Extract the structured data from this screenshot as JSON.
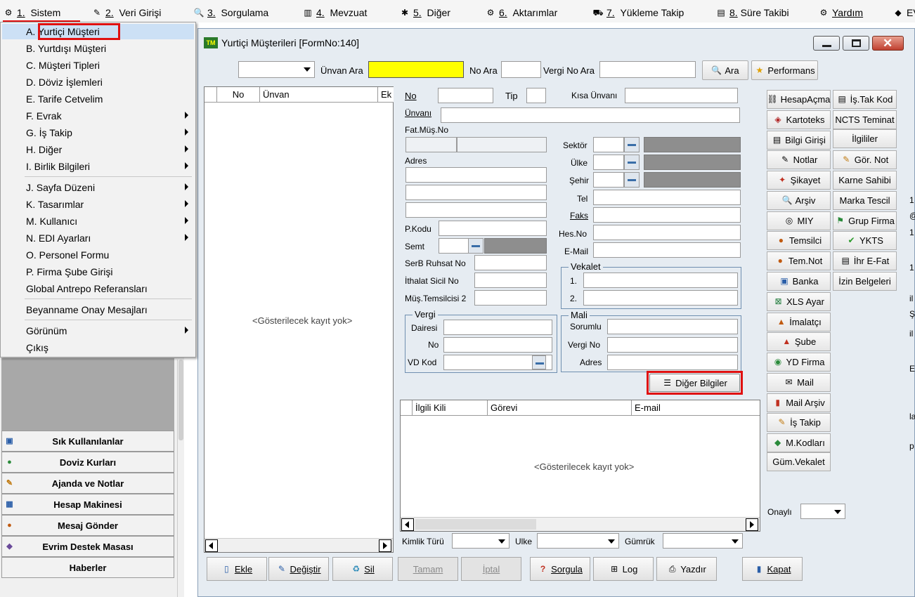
{
  "menubar": {
    "items": [
      {
        "num": "1.",
        "label": "Sistem",
        "icon": "gear-icon"
      },
      {
        "num": "2.",
        "label": "Veri Girişi",
        "icon": "pencil-icon"
      },
      {
        "num": "3.",
        "label": "Sorgulama",
        "icon": "search-icon"
      },
      {
        "num": "4.",
        "label": "Mevzuat",
        "icon": "books-icon"
      },
      {
        "num": "5.",
        "label": "Diğer",
        "icon": "tools-icon"
      },
      {
        "num": "6.",
        "label": "Aktarımlar",
        "icon": "transfer-icon"
      },
      {
        "num": "7.",
        "label": "Yükleme Takip",
        "icon": "truck-icon"
      },
      {
        "num": "8.",
        "label": "Süre Takibi",
        "icon": "clock-icon"
      },
      {
        "num": "",
        "label": "Yardım",
        "icon": "help-icon"
      },
      {
        "num": "",
        "label": "EV",
        "icon": "book-icon"
      }
    ]
  },
  "dropdown": {
    "items": [
      {
        "label": "A.  Yurtiçi Müşteri",
        "has_sub": false,
        "selected": true
      },
      {
        "label": "B.  Yurtdışı Müşteri",
        "has_sub": false
      },
      {
        "label": "C.  Müşteri Tipleri",
        "has_sub": false
      },
      {
        "label": "D.  Döviz İşlemleri",
        "has_sub": false
      },
      {
        "label": "E.  Tarife Cetvelim",
        "has_sub": false
      },
      {
        "label": "F.  Evrak",
        "has_sub": true
      },
      {
        "label": "G.  İş Takip",
        "has_sub": true
      },
      {
        "label": "H.  Diğer",
        "has_sub": true
      },
      {
        "label": "I.  Birlik Bilgileri",
        "has_sub": true
      },
      {
        "label": "J.  Sayfa Düzeni",
        "has_sub": true
      },
      {
        "label": "K.  Tasarımlar",
        "has_sub": true
      },
      {
        "label": "M.  Kullanıcı",
        "has_sub": true
      },
      {
        "label": "N.  EDI Ayarları",
        "has_sub": true
      },
      {
        "label": "O.  Personel Formu",
        "has_sub": false
      },
      {
        "label": "P.  Firma Şube Girişi",
        "has_sub": false
      },
      {
        "label": "Global Antrepo Referansları",
        "has_sub": false
      },
      {
        "label": "Beyanname Onay Mesajları",
        "has_sub": false
      },
      {
        "label": "Görünüm",
        "has_sub": true
      },
      {
        "label": "Çıkış",
        "has_sub": false
      }
    ]
  },
  "leftpanel": {
    "buttons": [
      {
        "label": "Sık Kullanılanlar",
        "icon": "star-list-icon"
      },
      {
        "label": "Doviz Kurları",
        "icon": "currency-icon"
      },
      {
        "label": "Ajanda ve Notlar",
        "icon": "notebook-icon"
      },
      {
        "label": "Hesap Makinesi",
        "icon": "calculator-icon"
      },
      {
        "label": "Mesaj Gönder",
        "icon": "users-icon"
      },
      {
        "label": "Evrim Destek Masası",
        "icon": "support-icon"
      },
      {
        "label": "Haberler",
        "icon": ""
      }
    ]
  },
  "window": {
    "title": "Yurtiçi Müşterileri [FormNo:140]",
    "search": {
      "unvan_ara": "Ünvan Ara",
      "no_ara": "No Ara",
      "vergi_no_ara": "Vergi No Ara",
      "ara_button": "Ara",
      "performans_button": "Performans"
    },
    "left_grid": {
      "columns": [
        "No",
        "Ünvan",
        "Ek"
      ],
      "empty_text": "<Gösterilecek kayıt yok>"
    },
    "form": {
      "no": "No",
      "tip": "Tip",
      "kisa_unvani": "Kısa Ünvanı",
      "unvani": "Ünvanı",
      "fat_mus_no": "Fat.Müş.No",
      "adres": "Adres",
      "pkodu": "P.Kodu",
      "semt": "Semt",
      "serb_ruhsat": "SerB Ruhsat No",
      "ithalat_sicil": "İthalat Sicil No",
      "mus_temsilcisi2": "Müş.Temsilcisi 2",
      "sektor": "Sektör",
      "ulke": "Ülke",
      "sehir": "Şehir",
      "tel": "Tel",
      "faks": "Faks",
      "hes_no": "Hes.No",
      "email": "E-Mail",
      "vekalet_group": "Vekalet",
      "vekalet_1": "1.",
      "vekalet_2": "2.",
      "vergi_group": "Vergi",
      "vergi_dairesi": "Dairesi",
      "vergi_no": "No",
      "vd_kod": "VD Kod",
      "mali_group": "Mali",
      "mali_sorumlu": "Sorumlu",
      "mali_vergi_no": "Vergi No",
      "mali_adres": "Adres",
      "diger_bilgiler": "Diğer Bilgiler"
    },
    "contact_grid": {
      "columns": [
        "İlgili Kili",
        "Görevi",
        "E-mail"
      ],
      "empty_text": "<Gösterilecek kayıt yok>"
    },
    "filters": {
      "kimlik_turu": "Kimlik Türü",
      "ulke": "Ulke",
      "gumruk": "Gümrük"
    },
    "right_buttons_col1": [
      {
        "label": "HesapAçma",
        "icon": "link-icon"
      },
      {
        "label": "Kartoteks",
        "icon": "card-icon"
      },
      {
        "label": "Bilgi Girişi",
        "icon": "info-icon"
      },
      {
        "label": "Notlar",
        "icon": "notes-icon"
      },
      {
        "label": "Şikayet",
        "icon": "complaint-icon"
      },
      {
        "label": "Arşiv",
        "icon": "archive-icon"
      },
      {
        "label": "MIY",
        "icon": "miy-icon"
      },
      {
        "label": "Temsilci",
        "icon": "representative-icon"
      },
      {
        "label": "Tem.Not",
        "icon": "representative-note-icon"
      },
      {
        "label": "Banka",
        "icon": "bank-icon"
      },
      {
        "label": "XLS Ayar",
        "icon": "excel-icon"
      },
      {
        "label": "İmalatçı",
        "icon": "factory-icon"
      },
      {
        "label": "Şube",
        "icon": "branch-icon"
      },
      {
        "label": "YD Firma",
        "icon": "foreign-firm-icon"
      },
      {
        "label": "Mail",
        "icon": "mail-icon"
      },
      {
        "label": "Mail Arşiv",
        "icon": "mail-archive-icon"
      },
      {
        "label": "İş Takip",
        "icon": "task-icon"
      },
      {
        "label": "M.Kodları",
        "icon": "codes-icon"
      },
      {
        "label": "Güm.Vekalet",
        "icon": ""
      }
    ],
    "right_buttons_col2": [
      {
        "label": "İş.Tak Kod",
        "icon": "clipboard-icon"
      },
      {
        "label": "NCTS Teminat",
        "icon": ""
      },
      {
        "label": "İlgililer",
        "icon": ""
      },
      {
        "label": "Gör. Not",
        "icon": "view-note-icon"
      },
      {
        "label": "Karne Sahibi",
        "icon": ""
      },
      {
        "label": "Marka Tescil",
        "icon": ""
      },
      {
        "label": "Grup Firma",
        "icon": "group-icon"
      },
      {
        "label": "YKTS",
        "icon": "check-icon"
      },
      {
        "label": "İhr E-Fat",
        "icon": "invoice-icon"
      },
      {
        "label": "İzin Belgeleri",
        "icon": ""
      }
    ],
    "onayli": "Onaylı",
    "bottom_buttons": [
      {
        "label": "Ekle",
        "icon": "add-doc-icon",
        "enabled": true
      },
      {
        "label": "Değiştir",
        "icon": "edit-icon",
        "enabled": true
      },
      {
        "label": "Sil",
        "icon": "recycle-icon",
        "enabled": true
      },
      {
        "label": "Tamam",
        "icon": "",
        "enabled": false
      },
      {
        "label": "İptal",
        "icon": "",
        "enabled": false
      },
      {
        "label": "Sorgula",
        "icon": "query-icon",
        "enabled": true
      },
      {
        "label": "Log",
        "icon": "log-icon",
        "enabled": true
      },
      {
        "label": "Yazdır",
        "icon": "printer-icon",
        "enabled": true
      },
      {
        "label": "Kapat",
        "icon": "exit-icon",
        "enabled": true
      }
    ]
  },
  "right_edge": {
    "chars": [
      "1",
      "@",
      "1",
      "1",
      "il",
      "Ş",
      "il",
      "E",
      "la",
      "p"
    ]
  },
  "colors": {
    "window_bg": "#e6ecf2",
    "highlight_yellow": "#ffff00",
    "selection": "#cce0f5",
    "red_annotation": "#e01010",
    "lookup_gray": "#8e8e8e"
  }
}
